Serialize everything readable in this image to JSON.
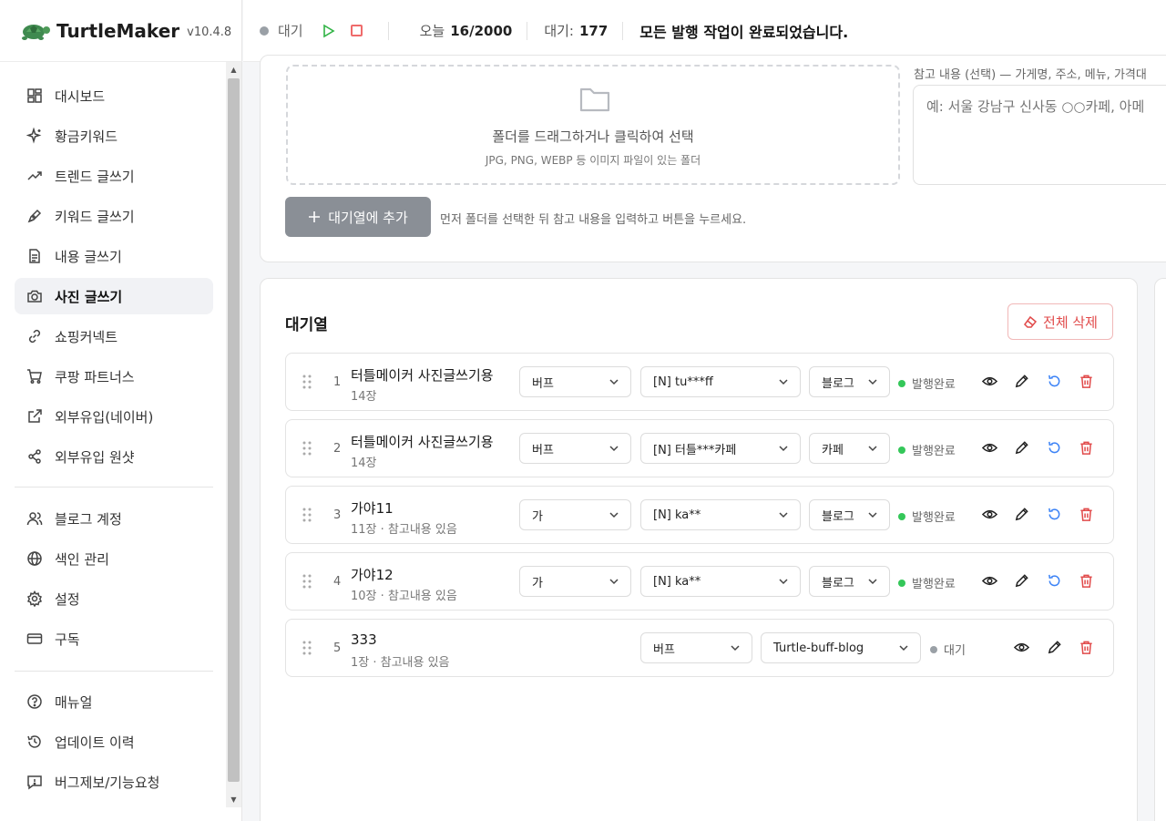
{
  "brand": {
    "name": "TurtleMaker",
    "version": "v10.4.8"
  },
  "nav": {
    "items": [
      {
        "label": "대시보드",
        "icon": "dashboard-icon"
      },
      {
        "label": "황금키워드",
        "icon": "sparkle-icon"
      },
      {
        "label": "트렌드 글쓰기",
        "icon": "trend-icon"
      },
      {
        "label": "키워드 글쓰기",
        "icon": "pen-icon"
      },
      {
        "label": "내용 글쓰기",
        "icon": "document-icon"
      },
      {
        "label": "사진 글쓰기",
        "icon": "camera-icon",
        "active": true
      },
      {
        "label": "쇼핑커넥트",
        "icon": "link-icon"
      },
      {
        "label": "쿠팡 파트너스",
        "icon": "cart-icon"
      },
      {
        "label": "외부유입(네이버)",
        "icon": "external-link-icon"
      },
      {
        "label": "외부유입 원샷",
        "icon": "share-icon"
      },
      {
        "label": "블로그 계정",
        "icon": "users-icon"
      },
      {
        "label": "색인 관리",
        "icon": "globe-icon"
      },
      {
        "label": "설정",
        "icon": "gear-icon"
      },
      {
        "label": "구독",
        "icon": "card-icon"
      },
      {
        "label": "매뉴얼",
        "icon": "help-icon"
      },
      {
        "label": "업데이트 이력",
        "icon": "history-icon"
      },
      {
        "label": "버그제보/기능요청",
        "icon": "feedback-icon"
      }
    ]
  },
  "topbar": {
    "status": "대기",
    "today_label": "오늘",
    "today_value": "16/2000",
    "wait_label": "대기:",
    "wait_value": "177",
    "message": "모든 발행 작업이 완료되었습니다."
  },
  "upload": {
    "dropzone_title": "폴더를 드래그하거나 클릭하여 선택",
    "dropzone_sub": "JPG, PNG, WEBP 등 이미지 파일이 있는 폴더",
    "ref_label": "참고 내용 (선택) — 가게명, 주소, 메뉴, 가격대",
    "ref_placeholder": "예: 서울 강남구 신사동 ○○카페, 아메",
    "add_button": "대기열에 추가",
    "add_hint": "먼저 폴더를 선택한 뒤 참고 내용을 입력하고 버튼을 누르세요."
  },
  "queue": {
    "title": "대기열",
    "clear_button": "전체 삭제",
    "rows": [
      {
        "index": "1",
        "title": "터틀메이커 사진글쓰기용",
        "sub": "14장",
        "style": "버프",
        "account": "[N] tu***ff",
        "type": "블로그",
        "status": "발행완료",
        "done": true
      },
      {
        "index": "2",
        "title": "터틀메이커 사진글쓰기용",
        "sub": "14장",
        "style": "버프",
        "account": "[N] 터틀***카페",
        "type": "카페",
        "status": "발행완료",
        "done": true
      },
      {
        "index": "3",
        "title": "가야11",
        "sub": "11장 · 참고내용 있음",
        "style": "가",
        "account": "[N] ka**",
        "type": "블로그",
        "status": "발행완료",
        "done": true
      },
      {
        "index": "4",
        "title": "가야12",
        "sub": "10장 · 참고내용 있음",
        "style": "가",
        "account": "[N] ka**",
        "type": "블로그",
        "status": "발행완료",
        "done": true
      },
      {
        "index": "5",
        "title": "333",
        "sub": "1장 · 참고내용 있음",
        "style": "버프",
        "account": "Turtle-buff-blog",
        "status": "대기",
        "done": false
      }
    ]
  },
  "colors": {
    "done": "#34c759",
    "pending": "#9aa0a6",
    "danger": "#e14b4b",
    "play": "#2fb344",
    "retry": "#3b82f6"
  }
}
